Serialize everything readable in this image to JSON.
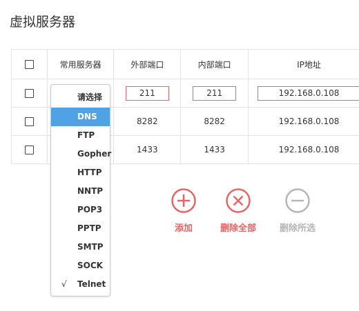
{
  "page": {
    "title": "虚拟服务器"
  },
  "table": {
    "headers": [
      "常用服务器",
      "外部端口",
      "内部端口",
      "IP地址"
    ],
    "edit_row": {
      "ext_port": "211",
      "int_port": "211",
      "ip": "192.168.0.108"
    },
    "rows": [
      {
        "ext_port": "8282",
        "int_port": "8282",
        "ip": "192.168.0.108"
      },
      {
        "ext_port": "1433",
        "int_port": "1433",
        "ip": "192.168.0.108"
      }
    ]
  },
  "dropdown": {
    "options": [
      "请选择",
      "DNS",
      "FTP",
      "Gopher",
      "HTTP",
      "NNTP",
      "POP3",
      "PPTP",
      "SMTP",
      "SOCK",
      "Telnet"
    ],
    "highlighted": "DNS",
    "checked": "Telnet",
    "check_mark": "√"
  },
  "actions": {
    "add_label": "添加",
    "delete_all_label": "删除全部",
    "delete_selected_label": "删除所选",
    "add_color": "#e86464",
    "delete_all_color": "#e86464",
    "delete_selected_color": "#b5b5b5"
  }
}
